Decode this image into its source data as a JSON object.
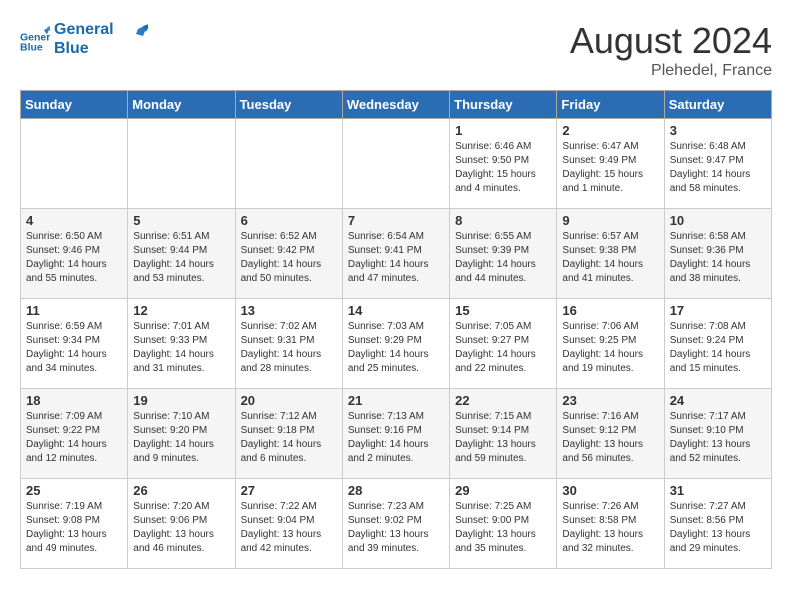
{
  "header": {
    "logo_line1": "General",
    "logo_line2": "Blue",
    "title": "August 2024",
    "subtitle": "Plehedel, France"
  },
  "days_of_week": [
    "Sunday",
    "Monday",
    "Tuesday",
    "Wednesday",
    "Thursday",
    "Friday",
    "Saturday"
  ],
  "weeks": [
    {
      "days": [
        {
          "num": "",
          "info": ""
        },
        {
          "num": "",
          "info": ""
        },
        {
          "num": "",
          "info": ""
        },
        {
          "num": "",
          "info": ""
        },
        {
          "num": "1",
          "info": "Sunrise: 6:46 AM\nSunset: 9:50 PM\nDaylight: 15 hours\nand 4 minutes."
        },
        {
          "num": "2",
          "info": "Sunrise: 6:47 AM\nSunset: 9:49 PM\nDaylight: 15 hours\nand 1 minute."
        },
        {
          "num": "3",
          "info": "Sunrise: 6:48 AM\nSunset: 9:47 PM\nDaylight: 14 hours\nand 58 minutes."
        }
      ]
    },
    {
      "days": [
        {
          "num": "4",
          "info": "Sunrise: 6:50 AM\nSunset: 9:46 PM\nDaylight: 14 hours\nand 55 minutes."
        },
        {
          "num": "5",
          "info": "Sunrise: 6:51 AM\nSunset: 9:44 PM\nDaylight: 14 hours\nand 53 minutes."
        },
        {
          "num": "6",
          "info": "Sunrise: 6:52 AM\nSunset: 9:42 PM\nDaylight: 14 hours\nand 50 minutes."
        },
        {
          "num": "7",
          "info": "Sunrise: 6:54 AM\nSunset: 9:41 PM\nDaylight: 14 hours\nand 47 minutes."
        },
        {
          "num": "8",
          "info": "Sunrise: 6:55 AM\nSunset: 9:39 PM\nDaylight: 14 hours\nand 44 minutes."
        },
        {
          "num": "9",
          "info": "Sunrise: 6:57 AM\nSunset: 9:38 PM\nDaylight: 14 hours\nand 41 minutes."
        },
        {
          "num": "10",
          "info": "Sunrise: 6:58 AM\nSunset: 9:36 PM\nDaylight: 14 hours\nand 38 minutes."
        }
      ]
    },
    {
      "days": [
        {
          "num": "11",
          "info": "Sunrise: 6:59 AM\nSunset: 9:34 PM\nDaylight: 14 hours\nand 34 minutes."
        },
        {
          "num": "12",
          "info": "Sunrise: 7:01 AM\nSunset: 9:33 PM\nDaylight: 14 hours\nand 31 minutes."
        },
        {
          "num": "13",
          "info": "Sunrise: 7:02 AM\nSunset: 9:31 PM\nDaylight: 14 hours\nand 28 minutes."
        },
        {
          "num": "14",
          "info": "Sunrise: 7:03 AM\nSunset: 9:29 PM\nDaylight: 14 hours\nand 25 minutes."
        },
        {
          "num": "15",
          "info": "Sunrise: 7:05 AM\nSunset: 9:27 PM\nDaylight: 14 hours\nand 22 minutes."
        },
        {
          "num": "16",
          "info": "Sunrise: 7:06 AM\nSunset: 9:25 PM\nDaylight: 14 hours\nand 19 minutes."
        },
        {
          "num": "17",
          "info": "Sunrise: 7:08 AM\nSunset: 9:24 PM\nDaylight: 14 hours\nand 15 minutes."
        }
      ]
    },
    {
      "days": [
        {
          "num": "18",
          "info": "Sunrise: 7:09 AM\nSunset: 9:22 PM\nDaylight: 14 hours\nand 12 minutes."
        },
        {
          "num": "19",
          "info": "Sunrise: 7:10 AM\nSunset: 9:20 PM\nDaylight: 14 hours\nand 9 minutes."
        },
        {
          "num": "20",
          "info": "Sunrise: 7:12 AM\nSunset: 9:18 PM\nDaylight: 14 hours\nand 6 minutes."
        },
        {
          "num": "21",
          "info": "Sunrise: 7:13 AM\nSunset: 9:16 PM\nDaylight: 14 hours\nand 2 minutes."
        },
        {
          "num": "22",
          "info": "Sunrise: 7:15 AM\nSunset: 9:14 PM\nDaylight: 13 hours\nand 59 minutes."
        },
        {
          "num": "23",
          "info": "Sunrise: 7:16 AM\nSunset: 9:12 PM\nDaylight: 13 hours\nand 56 minutes."
        },
        {
          "num": "24",
          "info": "Sunrise: 7:17 AM\nSunset: 9:10 PM\nDaylight: 13 hours\nand 52 minutes."
        }
      ]
    },
    {
      "days": [
        {
          "num": "25",
          "info": "Sunrise: 7:19 AM\nSunset: 9:08 PM\nDaylight: 13 hours\nand 49 minutes."
        },
        {
          "num": "26",
          "info": "Sunrise: 7:20 AM\nSunset: 9:06 PM\nDaylight: 13 hours\nand 46 minutes."
        },
        {
          "num": "27",
          "info": "Sunrise: 7:22 AM\nSunset: 9:04 PM\nDaylight: 13 hours\nand 42 minutes."
        },
        {
          "num": "28",
          "info": "Sunrise: 7:23 AM\nSunset: 9:02 PM\nDaylight: 13 hours\nand 39 minutes."
        },
        {
          "num": "29",
          "info": "Sunrise: 7:25 AM\nSunset: 9:00 PM\nDaylight: 13 hours\nand 35 minutes."
        },
        {
          "num": "30",
          "info": "Sunrise: 7:26 AM\nSunset: 8:58 PM\nDaylight: 13 hours\nand 32 minutes."
        },
        {
          "num": "31",
          "info": "Sunrise: 7:27 AM\nSunset: 8:56 PM\nDaylight: 13 hours\nand 29 minutes."
        }
      ]
    }
  ]
}
